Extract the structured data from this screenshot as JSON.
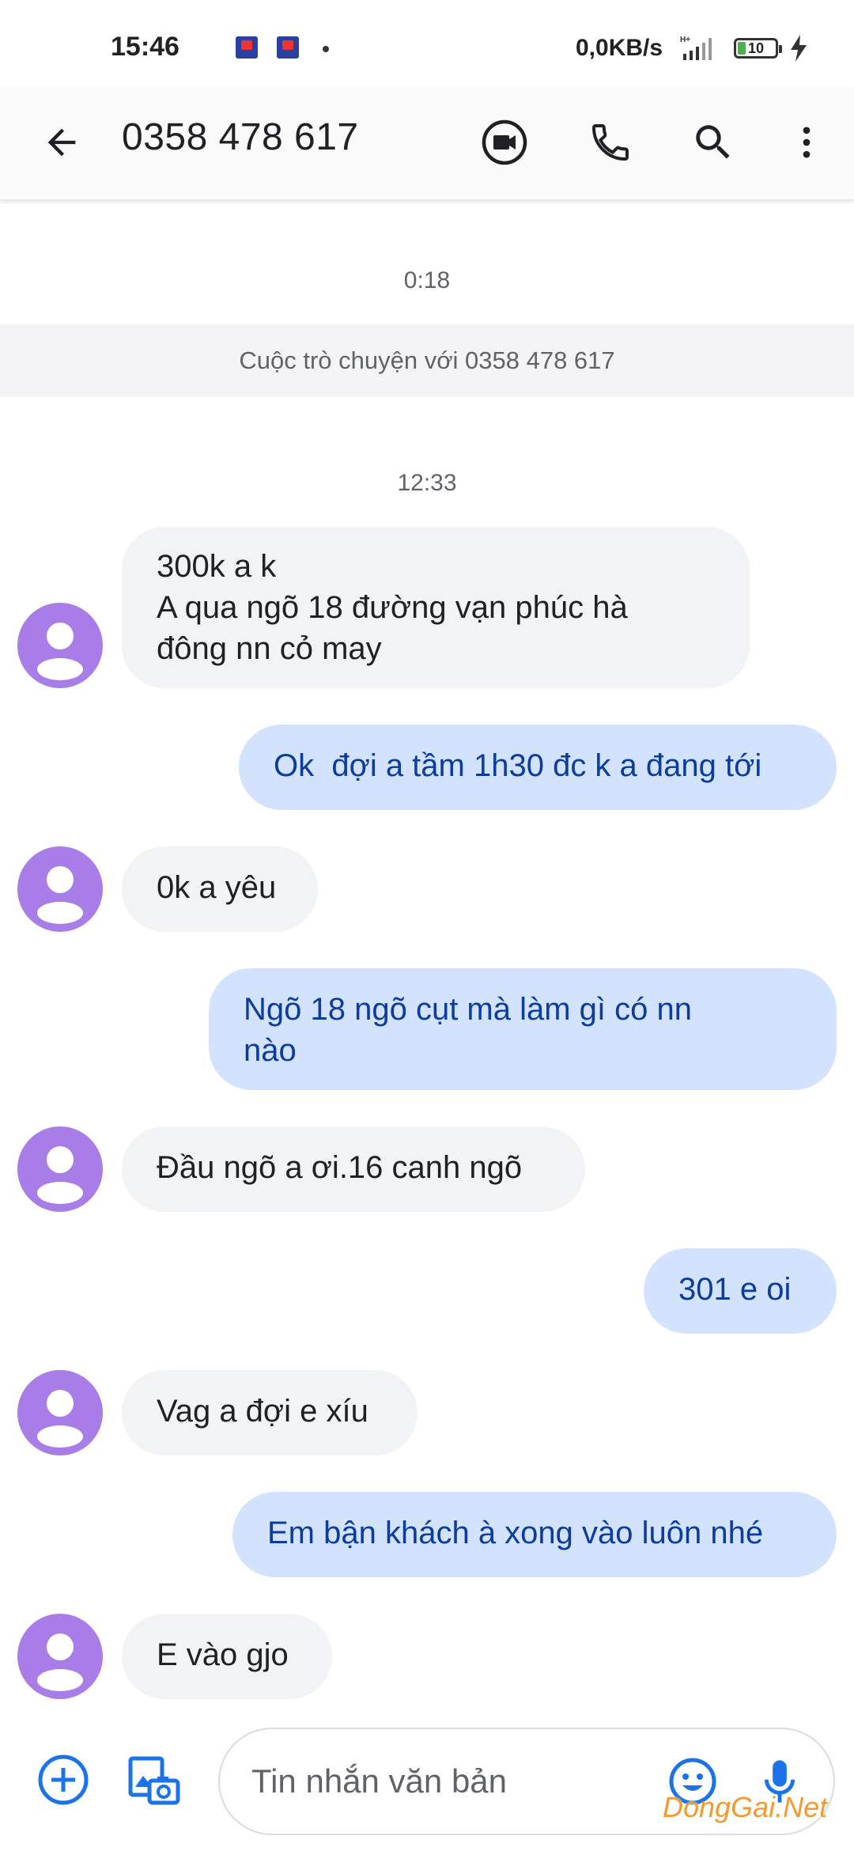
{
  "status_bar": {
    "time": "15:46",
    "net_speed": "0,0KB/s",
    "network_type": "H+",
    "battery_level": "10",
    "icons": [
      "bidv-app-icon",
      "bidv-app-icon",
      "notification-dot",
      "signal-icon",
      "battery-icon",
      "charging-icon"
    ]
  },
  "app_bar": {
    "title": "0358 478 617",
    "icons": [
      "back-arrow-icon",
      "video-call-icon",
      "phone-icon",
      "search-icon",
      "more-vert-icon"
    ]
  },
  "thread": {
    "timestamp_1": "0:18",
    "conversation_banner": "Cuộc trò chuyện với 0358 478 617",
    "timestamp_2": "12:33",
    "messages": [
      {
        "direction": "incoming",
        "text": "300k a k\nA qua ngõ 18 đường vạn phúc hà\nđông nn cỏ may"
      },
      {
        "direction": "outgoing",
        "text": "Ok  đợi a tầm 1h30 đc k a đang tới"
      },
      {
        "direction": "incoming",
        "text": "0k a yêu"
      },
      {
        "direction": "outgoing",
        "text": "Ngõ 18 ngõ cụt mà làm gì có nn\nnào"
      },
      {
        "direction": "incoming",
        "text": "Đầu ngõ a ơi.16 canh ngõ"
      },
      {
        "direction": "outgoing",
        "text": "301 e oi"
      },
      {
        "direction": "incoming",
        "text": "Vag a đợi e xíu"
      },
      {
        "direction": "outgoing",
        "text": "Em bận khách à xong vào luôn nhé"
      },
      {
        "direction": "incoming",
        "text": "E vào gjo"
      }
    ]
  },
  "compose": {
    "placeholder": "Tin nhắn văn bản",
    "icons": [
      "add-circle-icon",
      "gallery-camera-icon",
      "emoji-icon",
      "mic-icon"
    ]
  },
  "watermark": "DongGai.Net",
  "colors": {
    "avatar": "#a97de8",
    "incoming_bubble": "#f1f3f4",
    "outgoing_bubble": "#d3e3fd",
    "outgoing_text": "#0b3c9e",
    "accent": "#1a73e8"
  }
}
